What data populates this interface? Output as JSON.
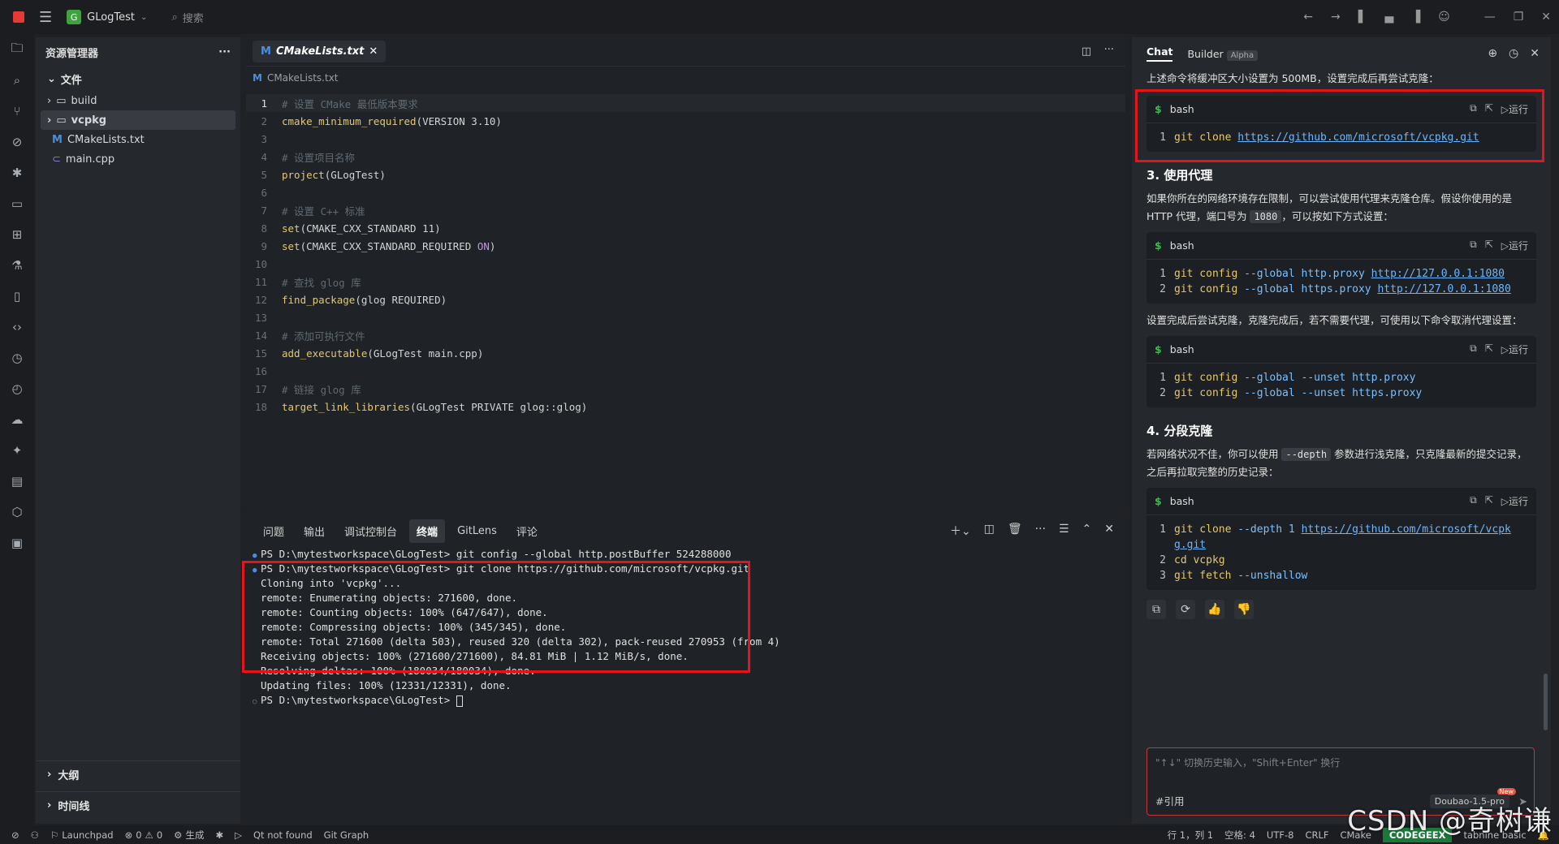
{
  "titlebar": {
    "project": "GLogTest",
    "project_initial": "G",
    "search": "搜索"
  },
  "explorer": {
    "title": "资源管理器",
    "section": "文件",
    "items": [
      {
        "name": "build",
        "type": "folder"
      },
      {
        "name": "vcpkg",
        "type": "folder"
      },
      {
        "name": "CMakeLists.txt",
        "type": "cmake"
      },
      {
        "name": "main.cpp",
        "type": "cpp"
      }
    ],
    "outline": "大纲",
    "timeline": "时间线"
  },
  "editor": {
    "tab": "CMakeLists.txt",
    "breadcrumb": "CMakeLists.txt",
    "lines": [
      {
        "n": "1",
        "parts": [
          [
            "cmt",
            "# 设置 CMake 最低版本要求"
          ]
        ]
      },
      {
        "n": "2",
        "parts": [
          [
            "fn",
            "cmake_minimum_required"
          ],
          [
            "tx",
            "(VERSION 3.10)"
          ]
        ]
      },
      {
        "n": "3",
        "parts": []
      },
      {
        "n": "4",
        "parts": [
          [
            "cmt",
            "# 设置项目名称"
          ]
        ]
      },
      {
        "n": "5",
        "parts": [
          [
            "fn",
            "project"
          ],
          [
            "tx",
            "(GLogTest)"
          ]
        ]
      },
      {
        "n": "6",
        "parts": []
      },
      {
        "n": "7",
        "parts": [
          [
            "cmt",
            "# 设置 C++ 标准"
          ]
        ]
      },
      {
        "n": "8",
        "parts": [
          [
            "fn",
            "set"
          ],
          [
            "tx",
            "(CMAKE_CXX_STANDARD 11)"
          ]
        ]
      },
      {
        "n": "9",
        "parts": [
          [
            "fn",
            "set"
          ],
          [
            "tx",
            "(CMAKE_CXX_STANDARD_REQUIRED "
          ],
          [
            "kw",
            "ON"
          ],
          [
            "tx",
            ")"
          ]
        ]
      },
      {
        "n": "10",
        "parts": []
      },
      {
        "n": "11",
        "parts": [
          [
            "cmt",
            "# 查找 glog 库"
          ]
        ]
      },
      {
        "n": "12",
        "parts": [
          [
            "fn",
            "find_package"
          ],
          [
            "tx",
            "(glog REQUIRED)"
          ]
        ]
      },
      {
        "n": "13",
        "parts": []
      },
      {
        "n": "14",
        "parts": [
          [
            "cmt",
            "# 添加可执行文件"
          ]
        ]
      },
      {
        "n": "15",
        "parts": [
          [
            "fn",
            "add_executable"
          ],
          [
            "tx",
            "(GLogTest main.cpp)"
          ]
        ]
      },
      {
        "n": "16",
        "parts": []
      },
      {
        "n": "17",
        "parts": [
          [
            "cmt",
            "# 链接 glog 库"
          ]
        ]
      },
      {
        "n": "18",
        "parts": [
          [
            "fn",
            "target_link_libraries"
          ],
          [
            "tx",
            "(GLogTest PRIVATE glog::glog)"
          ]
        ]
      }
    ]
  },
  "panel": {
    "tabs": [
      "问题",
      "输出",
      "调试控制台",
      "终端",
      "GitLens",
      "评论"
    ],
    "active_tab": "终端",
    "terminal": [
      {
        "dot": "filled",
        "text": "PS D:\\mytestworkspace\\GLogTest> git config --global http.postBuffer 524288000"
      },
      {
        "dot": "filled",
        "text": "PS D:\\mytestworkspace\\GLogTest> git clone https://github.com/microsoft/vcpkg.git"
      },
      {
        "dot": "",
        "text": "Cloning into 'vcpkg'..."
      },
      {
        "dot": "",
        "text": "remote: Enumerating objects: 271600, done."
      },
      {
        "dot": "",
        "text": "remote: Counting objects: 100% (647/647), done."
      },
      {
        "dot": "",
        "text": "remote: Compressing objects: 100% (345/345), done."
      },
      {
        "dot": "",
        "text": "remote: Total 271600 (delta 503), reused 320 (delta 302), pack-reused 270953 (from 4)"
      },
      {
        "dot": "",
        "text": "Receiving objects: 100% (271600/271600), 84.81 MiB | 1.12 MiB/s, done."
      },
      {
        "dot": "",
        "text": "Resolving deltas: 100% (180034/180034), done."
      },
      {
        "dot": "",
        "text": "Updating files: 100% (12331/12331), done."
      },
      {
        "dot": "empty",
        "text": "PS D:\\mytestworkspace\\GLogTest> "
      }
    ]
  },
  "chat": {
    "tab_chat": "Chat",
    "tab_builder": "Builder",
    "alpha": "Alpha",
    "intro": "上述命令将缓冲区大小设置为 500MB，设置完成后再尝试克隆：",
    "lang": "bash",
    "run": "运行",
    "block1": [
      {
        "n": "1",
        "c": "git clone https://github.com/microsoft/vcpkg.git"
      }
    ],
    "h3": "3. 使用代理",
    "p2a": "如果你所在的网络环境存在限制，可以尝试使用代理来克隆仓库。假设你使用的是 HTTP 代理，端口号为 ",
    "p2code": "1080",
    "p2b": "，可以按如下方式设置：",
    "block2": [
      {
        "n": "1",
        "a": "git config ",
        "o": "--global",
        "b": " http.proxy ",
        "l": "http://127.0.0.1:1080"
      },
      {
        "n": "2",
        "a": "git config ",
        "o": "--global",
        "b": " https.proxy ",
        "l": "http://127.0.0.1:1080"
      }
    ],
    "p3": "设置完成后尝试克隆，克隆完成后，若不需要代理，可使用以下命令取消代理设置：",
    "block3": [
      {
        "n": "1",
        "a": "git config ",
        "o": "--global --unset",
        "b": " http.proxy"
      },
      {
        "n": "2",
        "a": "git config ",
        "o": "--global --unset",
        "b": " https.proxy"
      }
    ],
    "h4": "4. 分段克隆",
    "p4a": "若网络状况不佳，你可以使用 ",
    "p4code": "--depth",
    "p4b": " 参数进行浅克隆，只克隆最新的提交记录，之后再拉取完整的历史记录：",
    "block4": [
      {
        "n": "1",
        "a": "git clone ",
        "o": "--depth 1",
        "b": " ",
        "l": "https://github.com/microsoft/vcpkg.git"
      },
      {
        "n": "2",
        "a": "cd vcpkg",
        "o": "",
        "b": "",
        "l": ""
      },
      {
        "n": "3",
        "a": "git fetch ",
        "o": "--unshallow",
        "b": "",
        "l": ""
      }
    ],
    "input_placeholder": "\"↑↓\" 切换历史输入，\"Shift+Enter\" 换行",
    "ref": "#引用",
    "model": "Doubao-1.5-pro",
    "new": "New"
  },
  "status": {
    "launchpad": "Launchpad",
    "errors": "0",
    "warnings": "0",
    "gen": "生成",
    "qt": "Qt not found",
    "gitgraph": "Git Graph",
    "pos": "行 1，列 1",
    "spaces": "空格: 4",
    "enc": "UTF-8",
    "eol": "CRLF",
    "lang": "CMake",
    "codegeex": "CODEGEEX",
    "tabnine": "tabnine basic"
  },
  "watermark": "CSDN @奇树谦",
  "colors": {
    "highlight": "#e3141b",
    "accent": "#4a8fdf",
    "codegeex": "#1b7a3a"
  }
}
